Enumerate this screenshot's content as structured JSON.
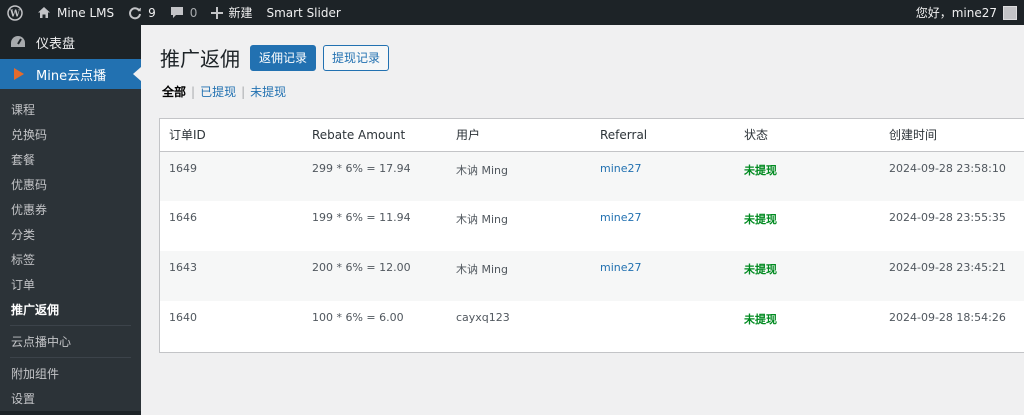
{
  "adminbar": {
    "site_name": "Mine LMS",
    "updates_count": "9",
    "comments_count": "0",
    "new_label": "新建",
    "plugin_label": "Smart Slider",
    "greeting": "您好，mine27"
  },
  "sidebar": {
    "dashboard": "仪表盘",
    "active_menu": "Mine云点播",
    "items": [
      {
        "label": "课程",
        "current": false
      },
      {
        "label": "兑换码",
        "current": false
      },
      {
        "label": "套餐",
        "current": false
      },
      {
        "label": "优惠码",
        "current": false
      },
      {
        "label": "优惠券",
        "current": false
      },
      {
        "label": "分类",
        "current": false
      },
      {
        "label": "标签",
        "current": false
      },
      {
        "label": "订单",
        "current": false
      },
      {
        "label": "推广返佣",
        "current": true
      }
    ],
    "after_sep_1": "云点播中心",
    "after_sep_2": [
      "附加组件",
      "设置"
    ]
  },
  "page": {
    "title": "推广返佣",
    "primary_button": "返佣记录",
    "secondary_button": "提现记录",
    "filters": {
      "all": "全部",
      "withdrawn": "已提现",
      "not_withdrawn": "未提现"
    }
  },
  "table": {
    "headers": [
      "订单ID",
      "Rebate Amount",
      "用户",
      "Referral",
      "状态",
      "创建时间"
    ],
    "rows": [
      {
        "order_id": "1649",
        "amount": "299 * 6% = 17.94",
        "user": "木讷 Ming",
        "referral": "mine27",
        "status": "未提现",
        "created": "2024-09-28 23:58:10"
      },
      {
        "order_id": "1646",
        "amount": "199 * 6% = 11.94",
        "user": "木讷 Ming",
        "referral": "mine27",
        "status": "未提现",
        "created": "2024-09-28 23:55:35"
      },
      {
        "order_id": "1643",
        "amount": "200 * 6% = 12.00",
        "user": "木讷 Ming",
        "referral": "mine27",
        "status": "未提现",
        "created": "2024-09-28 23:45:21"
      },
      {
        "order_id": "1640",
        "amount": "100 * 6% = 6.00",
        "user": "cayxq123",
        "referral": "",
        "status": "未提现",
        "created": "2024-09-28 18:54:26"
      }
    ]
  },
  "colors": {
    "accent": "#2271b1",
    "status_green": "#008a20",
    "admin_dark": "#1d2327"
  }
}
